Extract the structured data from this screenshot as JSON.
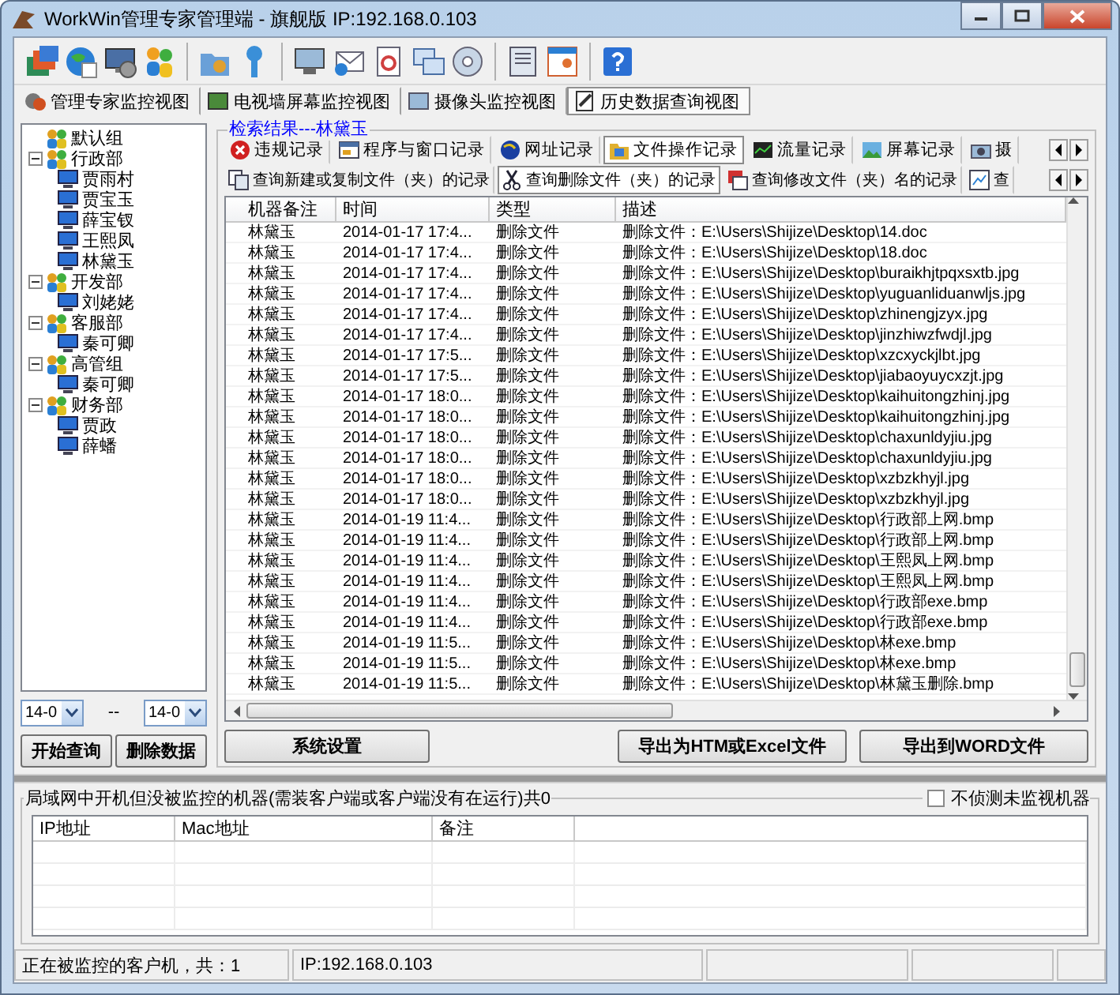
{
  "window": {
    "title": "WorkWin管理专家管理端 - 旗舰版 IP:192.168.0.103"
  },
  "view_tabs": [
    {
      "label": "管理专家监控视图",
      "selected": false
    },
    {
      "label": "电视墙屏幕监控视图",
      "selected": false
    },
    {
      "label": "摄像头监控视图",
      "selected": false
    },
    {
      "label": "历史数据查询视图",
      "selected": true
    }
  ],
  "tree": [
    {
      "label": "默认组",
      "kind": "group"
    },
    {
      "label": "行政部",
      "kind": "group",
      "expanded": true,
      "children": [
        {
          "label": "贾雨村",
          "kind": "computer"
        },
        {
          "label": "贾宝玉",
          "kind": "computer"
        },
        {
          "label": "薛宝钗",
          "kind": "computer"
        },
        {
          "label": "王熙凤",
          "kind": "computer"
        },
        {
          "label": "林黛玉",
          "kind": "computer"
        }
      ]
    },
    {
      "label": "开发部",
      "kind": "group",
      "expanded": true,
      "children": [
        {
          "label": "刘姥姥",
          "kind": "computer"
        }
      ]
    },
    {
      "label": "客服部",
      "kind": "group",
      "expanded": true,
      "children": [
        {
          "label": "秦可卿",
          "kind": "computer"
        }
      ]
    },
    {
      "label": "高管组",
      "kind": "group",
      "expanded": true,
      "children": [
        {
          "label": "秦可卿",
          "kind": "computer"
        }
      ]
    },
    {
      "label": "财务部",
      "kind": "group",
      "expanded": true,
      "children": [
        {
          "label": "贾政",
          "kind": "computer"
        },
        {
          "label": "薛蟠",
          "kind": "computer"
        }
      ]
    }
  ],
  "date_from": {
    "value": "14-0"
  },
  "date_separator": "--",
  "date_to": {
    "value": "14-0"
  },
  "query_buttons": [
    "开始查询",
    "删除数据"
  ],
  "results_title": "检索结果---林黛玉",
  "record_tabs": [
    {
      "label": "违规记录",
      "selected": false
    },
    {
      "label": "程序与窗口记录",
      "selected": false
    },
    {
      "label": "网址记录",
      "selected": false
    },
    {
      "label": "文件操作记录",
      "selected": true
    },
    {
      "label": "流量记录",
      "selected": false
    },
    {
      "label": "屏幕记录",
      "selected": false
    },
    {
      "label": "摄",
      "selected": false
    }
  ],
  "query_tabs": [
    {
      "label": "查询新建或复制文件（夹）的记录",
      "selected": false
    },
    {
      "label": "查询删除文件（夹）的记录",
      "selected": true
    },
    {
      "label": "查询修改文件（夹）名的记录",
      "selected": false
    },
    {
      "label": "查",
      "selected": false
    }
  ],
  "table": {
    "columns": [
      "机器备注",
      "时间",
      "类型",
      "描述"
    ],
    "rows": [
      [
        "林黛玉",
        "2014-01-17 17:4...",
        "删除文件",
        "删除文件：E:\\Users\\Shijize\\Desktop\\14.doc"
      ],
      [
        "林黛玉",
        "2014-01-17 17:4...",
        "删除文件",
        "删除文件：E:\\Users\\Shijize\\Desktop\\18.doc"
      ],
      [
        "林黛玉",
        "2014-01-17 17:4...",
        "删除文件",
        "删除文件：E:\\Users\\Shijize\\Desktop\\buraikhjtpqxsxtb.jpg"
      ],
      [
        "林黛玉",
        "2014-01-17 17:4...",
        "删除文件",
        "删除文件：E:\\Users\\Shijize\\Desktop\\yuguanliduanwljs.jpg"
      ],
      [
        "林黛玉",
        "2014-01-17 17:4...",
        "删除文件",
        "删除文件：E:\\Users\\Shijize\\Desktop\\zhinengjzyx.jpg"
      ],
      [
        "林黛玉",
        "2014-01-17 17:4...",
        "删除文件",
        "删除文件：E:\\Users\\Shijize\\Desktop\\jinzhiwzfwdjl.jpg"
      ],
      [
        "林黛玉",
        "2014-01-17 17:5...",
        "删除文件",
        "删除文件：E:\\Users\\Shijize\\Desktop\\xzcxyckjlbt.jpg"
      ],
      [
        "林黛玉",
        "2014-01-17 17:5...",
        "删除文件",
        "删除文件：E:\\Users\\Shijize\\Desktop\\jiabaoyuycxzjt.jpg"
      ],
      [
        "林黛玉",
        "2014-01-17 18:0...",
        "删除文件",
        "删除文件：E:\\Users\\Shijize\\Desktop\\kaihuitongzhinj.jpg"
      ],
      [
        "林黛玉",
        "2014-01-17 18:0...",
        "删除文件",
        "删除文件：E:\\Users\\Shijize\\Desktop\\kaihuitongzhinj.jpg"
      ],
      [
        "林黛玉",
        "2014-01-17 18:0...",
        "删除文件",
        "删除文件：E:\\Users\\Shijize\\Desktop\\chaxunldyjiu.jpg"
      ],
      [
        "林黛玉",
        "2014-01-17 18:0...",
        "删除文件",
        "删除文件：E:\\Users\\Shijize\\Desktop\\chaxunldyjiu.jpg"
      ],
      [
        "林黛玉",
        "2014-01-17 18:0...",
        "删除文件",
        "删除文件：E:\\Users\\Shijize\\Desktop\\xzbzkhyjl.jpg"
      ],
      [
        "林黛玉",
        "2014-01-17 18:0...",
        "删除文件",
        "删除文件：E:\\Users\\Shijize\\Desktop\\xzbzkhyjl.jpg"
      ],
      [
        "林黛玉",
        "2014-01-19 11:4...",
        "删除文件",
        "删除文件：E:\\Users\\Shijize\\Desktop\\行政部上网.bmp"
      ],
      [
        "林黛玉",
        "2014-01-19 11:4...",
        "删除文件",
        "删除文件：E:\\Users\\Shijize\\Desktop\\行政部上网.bmp"
      ],
      [
        "林黛玉",
        "2014-01-19 11:4...",
        "删除文件",
        "删除文件：E:\\Users\\Shijize\\Desktop\\王熙凤上网.bmp"
      ],
      [
        "林黛玉",
        "2014-01-19 11:4...",
        "删除文件",
        "删除文件：E:\\Users\\Shijize\\Desktop\\王熙凤上网.bmp"
      ],
      [
        "林黛玉",
        "2014-01-19 11:4...",
        "删除文件",
        "删除文件：E:\\Users\\Shijize\\Desktop\\行政部exe.bmp"
      ],
      [
        "林黛玉",
        "2014-01-19 11:4...",
        "删除文件",
        "删除文件：E:\\Users\\Shijize\\Desktop\\行政部exe.bmp"
      ],
      [
        "林黛玉",
        "2014-01-19 11:5...",
        "删除文件",
        "删除文件：E:\\Users\\Shijize\\Desktop\\林exe.bmp"
      ],
      [
        "林黛玉",
        "2014-01-19 11:5...",
        "删除文件",
        "删除文件：E:\\Users\\Shijize\\Desktop\\林exe.bmp"
      ],
      [
        "林黛玉",
        "2014-01-19 11:5...",
        "删除文件",
        "删除文件：E:\\Users\\Shijize\\Desktop\\林黛玉删除.bmp"
      ]
    ]
  },
  "settings_button": "系统设置",
  "export_buttons": [
    "导出为HTM或Excel文件",
    "导出到WORD文件"
  ],
  "unmonitored": {
    "title": "局域网中开机但没被监控的机器(需装客户端或客户端没有在运行)共0",
    "checkbox": {
      "label": "不侦测未监视机器",
      "checked": false
    },
    "columns": [
      "IP地址",
      "Mac地址",
      "备注"
    ]
  },
  "status_bar": [
    "正在被监控的客户机，共：1",
    "IP:192.168.0.103"
  ]
}
